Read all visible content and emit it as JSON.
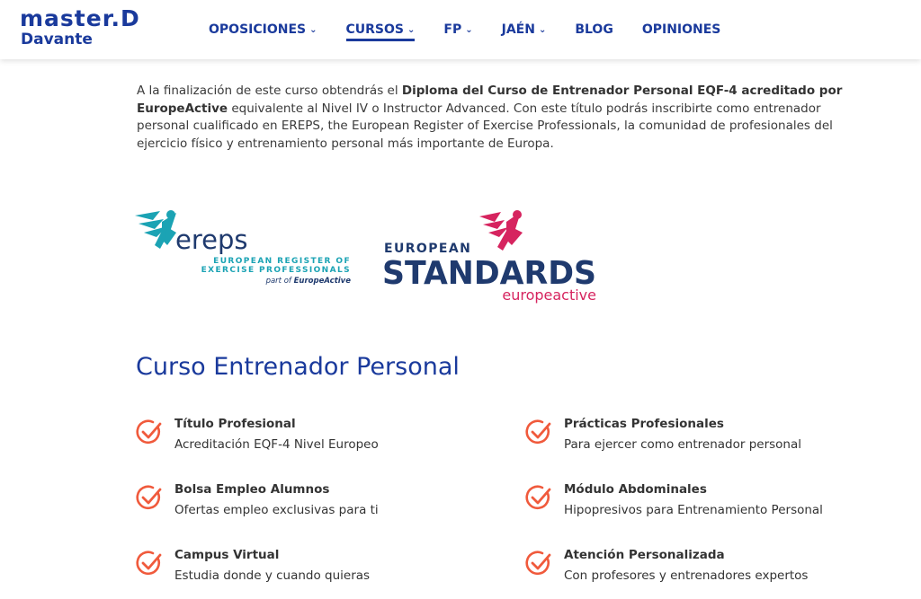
{
  "header": {
    "logo_line1": "master.D",
    "logo_line2": "Davante",
    "nav": [
      {
        "label": "OPOSICIONES",
        "has_dropdown": true,
        "active": false
      },
      {
        "label": "CURSOS",
        "has_dropdown": true,
        "active": true
      },
      {
        "label": "FP",
        "has_dropdown": true,
        "active": false
      },
      {
        "label": "JAÉN",
        "has_dropdown": true,
        "active": false
      },
      {
        "label": "BLOG",
        "has_dropdown": false,
        "active": false
      },
      {
        "label": "OPINIONES",
        "has_dropdown": false,
        "active": false
      }
    ]
  },
  "content": {
    "paragraph": {
      "intro": "A la finalización de este curso obtendrás el ",
      "bold": "Diploma del Curso de Entrenador Personal EQF-4 acreditado por EuropeActive",
      "rest": " equivalente al Nivel IV o Instructor Advanced. Con este título podrás inscribirte como entrenador personal cualificado en EREPS, the European Register of Exercise Professionals, la comunidad de profesionales del ejercicio físico y entrenamiento personal más importante de Europa."
    },
    "ereps_logo": {
      "name": "ereps",
      "line1": "EUROPEAN REGISTER OF",
      "line2": "EXERCISE PROFESSIONALS",
      "part_of": "part of ",
      "part_of_brand": "EuropeActive"
    },
    "standards_logo": {
      "top": "EUROPEAN",
      "main": "STANDARDS",
      "brand": "europeactive"
    },
    "section_title": "Curso Entrenador Personal",
    "features": [
      {
        "title": "Título Profesional",
        "desc": "Acreditación EQF-4 Nivel Europeo"
      },
      {
        "title": "Prácticas Profesionales",
        "desc": "Para ejercer como entrenador personal"
      },
      {
        "title": "Bolsa Empleo Alumnos",
        "desc": "Ofertas empleo exclusivas para ti"
      },
      {
        "title": "Módulo Abdominales",
        "desc": "Hipopresivos para Entrenamiento Personal"
      },
      {
        "title": "Campus Virtual",
        "desc": "Estudia donde y cuando quieras"
      },
      {
        "title": "Atención Personalizada",
        "desc": "Con profesores y entrenadores expertos"
      }
    ]
  },
  "colors": {
    "brand_blue": "#1a3a9c",
    "check_orange": "#f05a3c",
    "ereps_teal": "#1ba3b4",
    "standards_navy": "#1f3a6e",
    "standards_pink": "#d6245f"
  },
  "icons": {
    "nav_dropdown": "chevron-down-icon",
    "feature": "check-circle-icon"
  }
}
